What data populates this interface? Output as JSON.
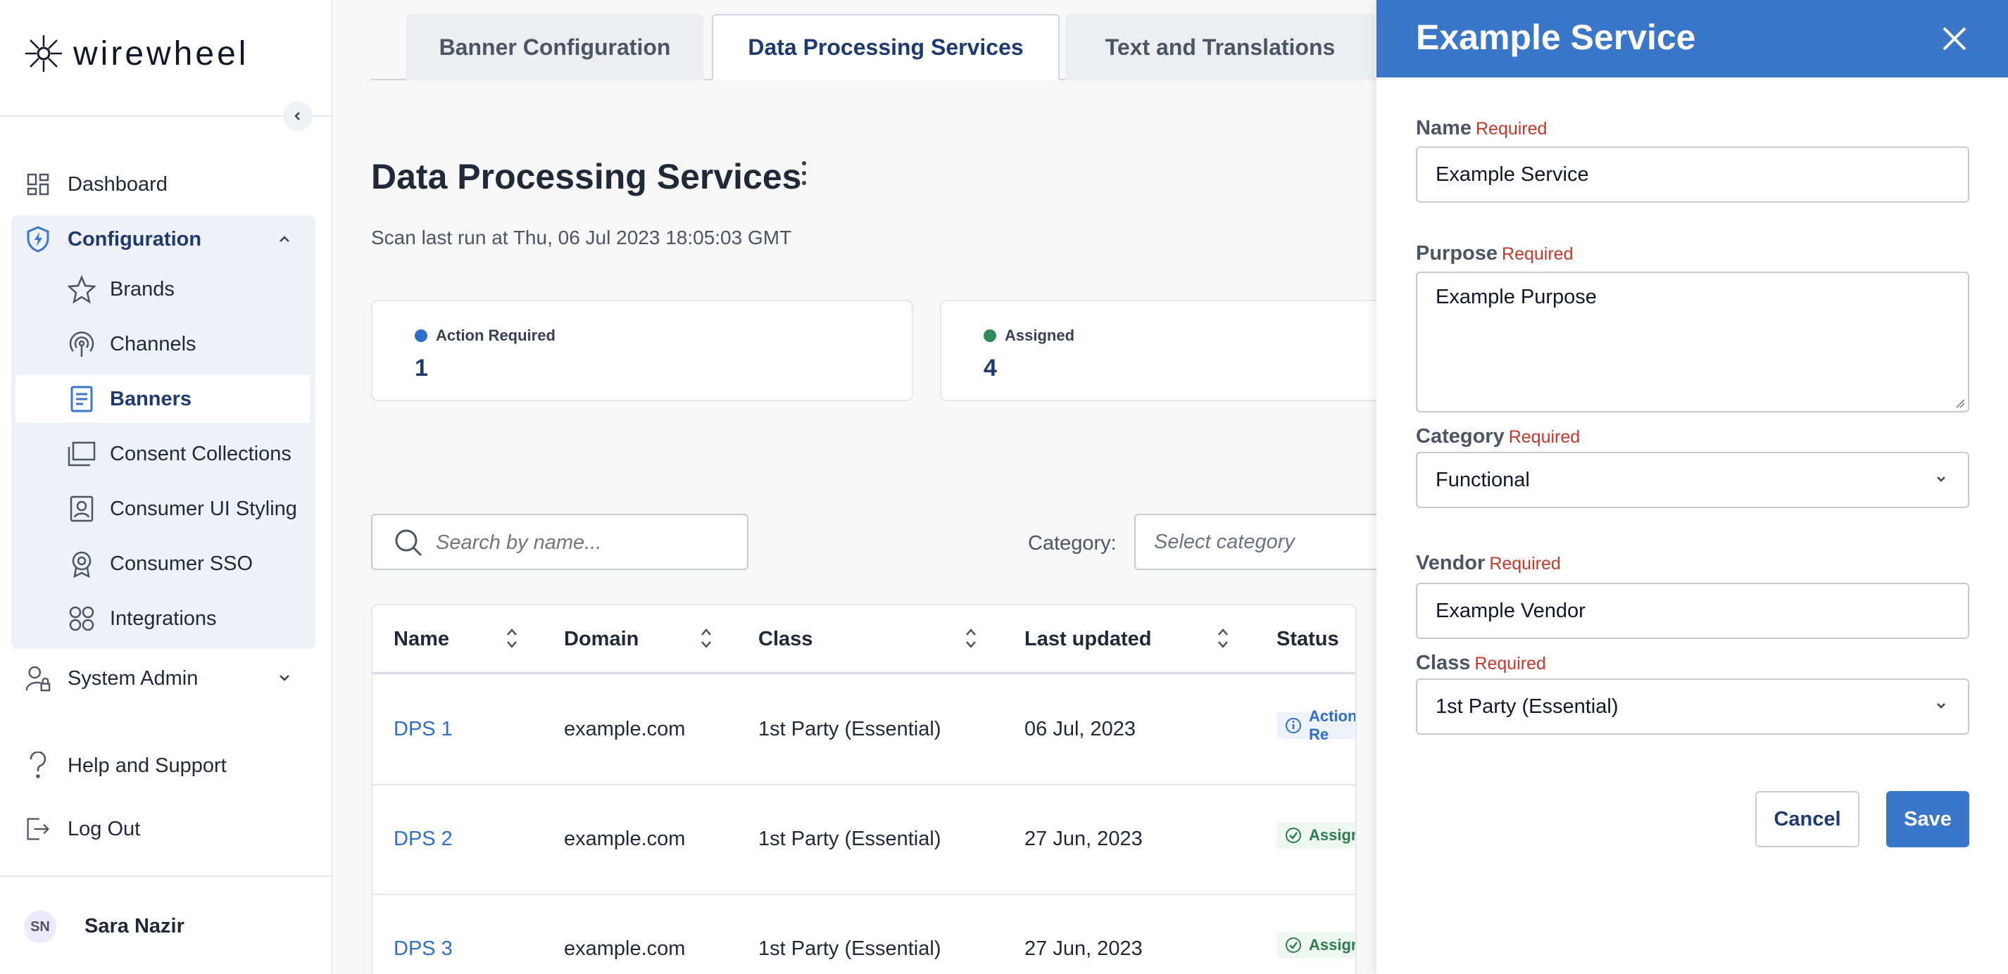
{
  "app": {
    "logo_text": "wirewheel"
  },
  "sidebar": {
    "dashboard": "Dashboard",
    "configuration": "Configuration",
    "sub_items": [
      "Brands",
      "Channels",
      "Banners",
      "Consent Collections",
      "Consumer UI Styling",
      "Consumer SSO",
      "Integrations"
    ],
    "active_sub_item": "Banners",
    "system_admin": "System Admin",
    "help": "Help and Support",
    "logout": "Log Out",
    "user": {
      "initials": "SN",
      "name": "Sara Nazir"
    }
  },
  "tabs": [
    "Banner Configuration",
    "Data Processing Services",
    "Text and Translations"
  ],
  "active_tab": "Data Processing Services",
  "page": {
    "title": "Data Processing Services",
    "scan_text": "Scan last run at Thu, 06 Jul 2023 18:05:03 GMT"
  },
  "stats": [
    {
      "label": "Action Required",
      "value": "1",
      "color": "#2f6fca"
    },
    {
      "label": "Assigned",
      "value": "4",
      "color": "#2e8b57"
    }
  ],
  "filters": {
    "search_placeholder": "Search by name...",
    "category_label": "Category:",
    "category_placeholder": "Select category"
  },
  "table": {
    "columns": [
      "Name",
      "Domain",
      "Class",
      "Last updated",
      "Status"
    ],
    "rows": [
      {
        "name": "DPS 1",
        "domain": "example.com",
        "class": "1st Party (Essential)",
        "updated": "06 Jul, 2023",
        "status": "Action Re"
      },
      {
        "name": "DPS 2",
        "domain": "example.com",
        "class": "1st Party (Essential)",
        "updated": "27 Jun, 2023",
        "status": "Assigned"
      },
      {
        "name": "DPS 3",
        "domain": "example.com",
        "class": "1st Party (Essential)",
        "updated": "27 Jun, 2023",
        "status": "Assigned"
      }
    ]
  },
  "drawer": {
    "title": "Example Service",
    "required_text": "Required",
    "fields": {
      "name": {
        "label": "Name",
        "value": "Example Service"
      },
      "purpose": {
        "label": "Purpose",
        "value": "Example Purpose"
      },
      "category": {
        "label": "Category",
        "value": "Functional"
      },
      "vendor": {
        "label": "Vendor",
        "value": "Example Vendor"
      },
      "class": {
        "label": "Class",
        "value": "1st Party (Essential)"
      }
    },
    "cancel": "Cancel",
    "save": "Save"
  },
  "colors": {
    "brand_blue": "#3a77c8",
    "link": "#2f6fca",
    "required": "#c0392b",
    "success": "#2e7d4f"
  }
}
